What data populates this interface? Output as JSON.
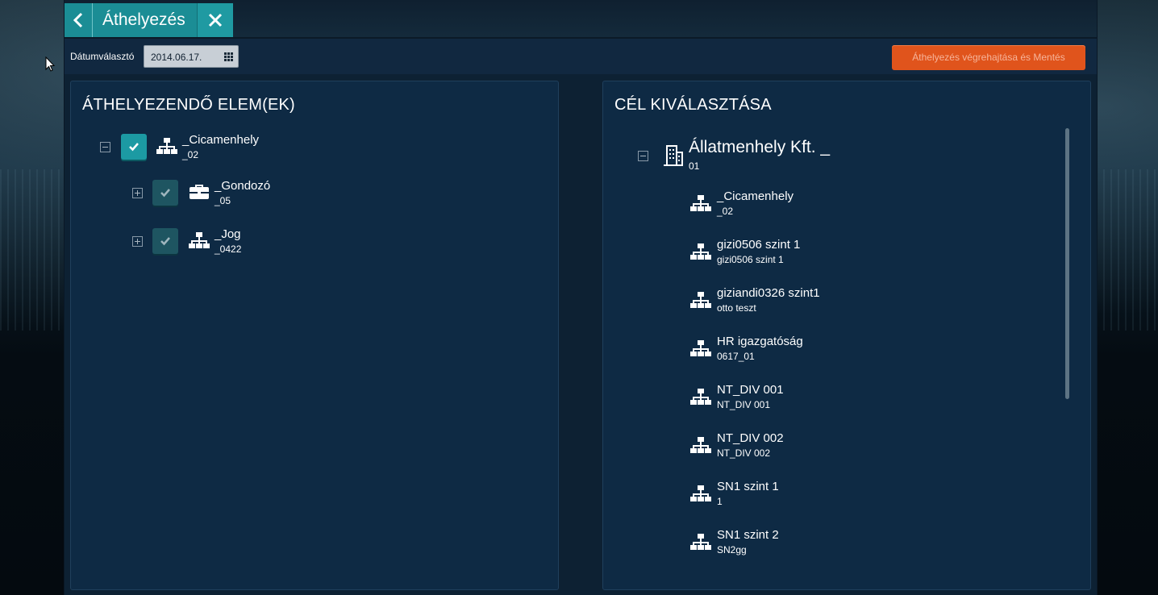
{
  "header": {
    "title": "Áthelyezés"
  },
  "toolbar": {
    "date_label": "Dátumválasztó",
    "date_value": "2014.06.17.",
    "save_label": "Áthelyezés végrehajtása és Mentés"
  },
  "left_panel": {
    "title": "ÁTHELYEZENDŐ ELEM(EK)",
    "items": [
      {
        "name": "_Cicamenhely",
        "code": "_02",
        "icon": "org-chart-icon",
        "checked": true
      },
      {
        "name": "_Gondozó",
        "code": "_05",
        "icon": "briefcase-icon",
        "checked": true
      },
      {
        "name": "_Jog",
        "code": "_0422",
        "icon": "org-chart-icon",
        "checked": true
      }
    ]
  },
  "right_panel": {
    "title": "CÉL KIVÁLASZTÁSA",
    "root": {
      "name": "Állatmenhely Kft. _",
      "code": "01",
      "icon": "building-icon"
    },
    "items": [
      {
        "name": "_Cicamenhely",
        "code": "_02"
      },
      {
        "name": "gizi0506 szint 1",
        "code": "gizi0506 szint 1"
      },
      {
        "name": "giziandi0326 szint1",
        "code": "otto teszt"
      },
      {
        "name": "HR igazgatóság",
        "code": "0617_01"
      },
      {
        "name": "NT_DIV 001",
        "code": "NT_DIV 001"
      },
      {
        "name": "NT_DIV 002",
        "code": "NT_DIV 002"
      },
      {
        "name": "SN1 szint 1",
        "code": "1"
      },
      {
        "name": "SN1 szint 2",
        "code": "SN2gg"
      }
    ]
  },
  "colors": {
    "accent": "#1b8d95",
    "save_button": "#e0541c",
    "panel_bg": "#0e2a44"
  }
}
